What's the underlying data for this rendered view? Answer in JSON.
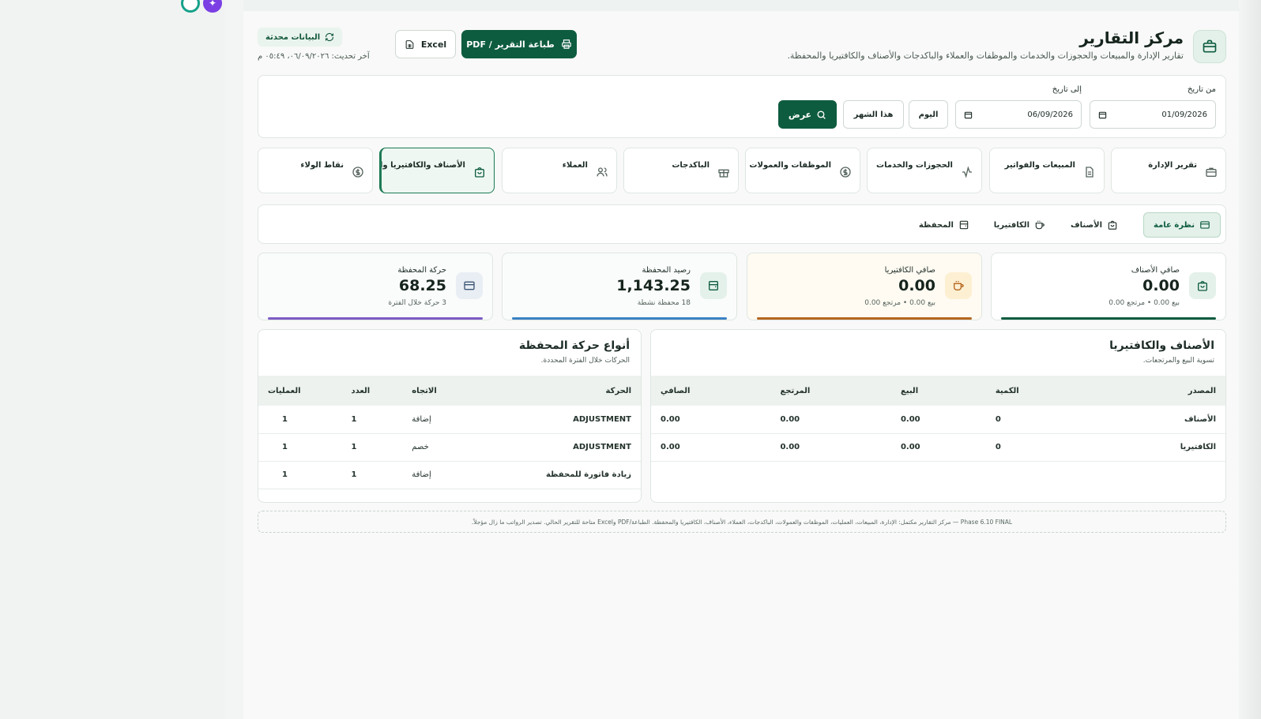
{
  "header": {
    "title": "مركز التقارير",
    "subtitle": "تقارير الإدارة والمبيعات والحجوزات والخدمات والموظفات والعملاء والباكدجات والأصناف والكافتيريا والمحفظة.",
    "print_label": "طباعة التقرير / PDF",
    "excel_label": "Excel",
    "updated_badge": "البيانات محدثة",
    "last_update": "آخر تحديث: ٠٦/٠٩/٢٠٢٦، ٠٥:٤٩ م"
  },
  "filters": {
    "from_label": "من تاريخ",
    "from_value": "01/09/2026",
    "to_label": "إلى تاريخ",
    "to_value": "06/09/2026",
    "today_label": "اليوم",
    "month_label": "هذا الشهر",
    "show_label": "عرض"
  },
  "report_tabs": [
    {
      "label": "تقرير الإدارة",
      "icon": "briefcase-icon"
    },
    {
      "label": "المبيعات والفواتير",
      "icon": "document-icon"
    },
    {
      "label": "الحجوزات والخدمات",
      "icon": "activity-icon"
    },
    {
      "label": "الموظفات والعمولات",
      "icon": "dollar-icon"
    },
    {
      "label": "الباكدجات",
      "icon": "gift-icon"
    },
    {
      "label": "العملاء",
      "icon": "users-icon"
    },
    {
      "label": "الأصناف والكافتيريا والمحفظة",
      "icon": "bag-icon"
    },
    {
      "label": "نقاط الولاء",
      "icon": "dollar-icon"
    }
  ],
  "sub_tabs": [
    {
      "label": "نظرة عامة",
      "icon": "card-icon"
    },
    {
      "label": "الأصناف",
      "icon": "bag-icon"
    },
    {
      "label": "الكافتيريا",
      "icon": "cup-icon"
    },
    {
      "label": "المحفظة",
      "icon": "wallet-icon"
    }
  ],
  "kpis": [
    {
      "title": "صافي الأصناف",
      "value": "0.00",
      "sub": "بيع 0.00 • مرتجع 0.00",
      "accent": "#0e5c40",
      "bg": "#ffffff",
      "icon_bg": "#e4f1ea",
      "icon": "bag-icon"
    },
    {
      "title": "صافي الكافتيريا",
      "value": "0.00",
      "sub": "بيع 0.00 • مرتجع 0.00",
      "accent": "#b5651d",
      "bg": "#fffbf2",
      "icon_bg": "#fdefd2",
      "icon": "cup-icon"
    },
    {
      "title": "رصيد المحفظة",
      "value": "1,143.25",
      "sub": "18 محفظة نشطة",
      "accent": "#3b82c4",
      "bg": "#fafcfb",
      "icon_bg": "#e4f1ea",
      "icon": "wallet-icon"
    },
    {
      "title": "حركة المحفظة",
      "value": "68.25",
      "sub": "3 حركة خلال الفترة",
      "accent": "#7c5cc4",
      "bg": "#fafcfb",
      "icon_bg": "#e9eef5",
      "icon": "card-icon"
    }
  ],
  "items_table": {
    "title": "الأصناف والكافتيريا",
    "subtitle": "تسوية البيع والمرتجعات.",
    "columns": [
      "المصدر",
      "الكمية",
      "البيع",
      "المرتجع",
      "الصافي"
    ],
    "rows": [
      [
        "الأصناف",
        "0",
        "0.00",
        "0.00",
        "0.00"
      ],
      [
        "الكافتيريا",
        "0",
        "0.00",
        "0.00",
        "0.00"
      ]
    ]
  },
  "wallet_table": {
    "title": "أنواع حركة المحفظة",
    "subtitle": "الحركات خلال الفترة المحددة.",
    "columns": [
      "الحركة",
      "الاتجاه",
      "العدد",
      "العمليات"
    ],
    "rows": [
      [
        "ADJUSTMENT",
        "إضافة",
        "1",
        "1"
      ],
      [
        "ADJUSTMENT",
        "خصم",
        "1",
        "1"
      ],
      [
        "زيادة فاتورة للمحفظة",
        "إضافة",
        "1",
        "1"
      ]
    ]
  },
  "footer_note": "Phase 6.10 FINAL — مركز التقارير مكتمل: الإدارة، المبيعات، العمليات، الموظفات والعمولات، الباكدجات، العملاء، الأصناف، الكافتيريا والمحفظة. الطباعة/PDF وExcel متاحة للتقرير الحالي. تصدير الرواتب ما زال مؤجلاً.",
  "colors": {
    "brand": "#0e5c40",
    "panel_border": "#dfe6e2"
  }
}
